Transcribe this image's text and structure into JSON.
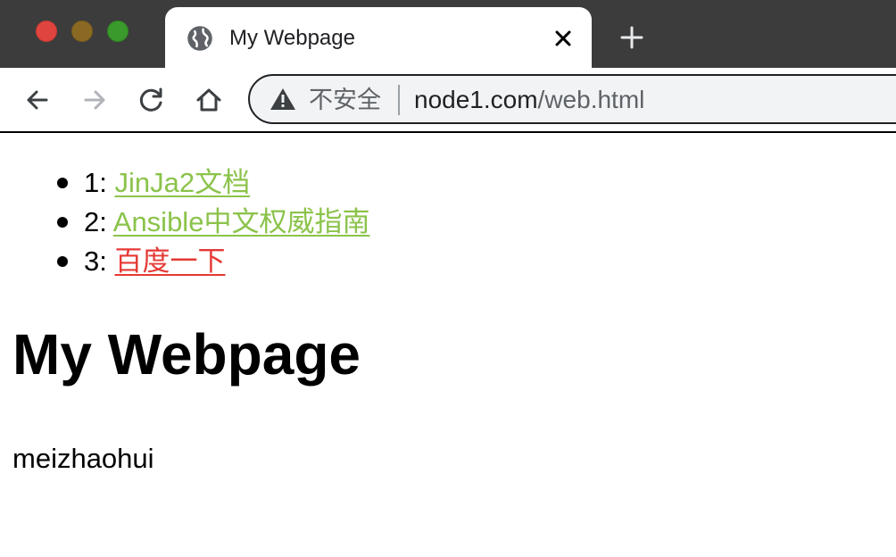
{
  "browser": {
    "tab": {
      "title": "My Webpage"
    },
    "address_bar": {
      "security_label": "不安全",
      "url_host": "node1.com",
      "url_path": "/web.html"
    },
    "icons": [
      "globe-icon",
      "close-icon",
      "plus-icon",
      "back-arrow-icon",
      "forward-arrow-icon",
      "reload-icon",
      "home-icon",
      "warning-icon"
    ]
  },
  "page": {
    "links": [
      {
        "prefix": "1:",
        "text": "JinJa2文档",
        "color": "#8bc34a"
      },
      {
        "prefix": "2:",
        "text": "Ansible中文权威指南",
        "color": "#8bc34a"
      },
      {
        "prefix": "3:",
        "text": "百度一下",
        "color": "#e53935"
      }
    ],
    "heading": "My Webpage",
    "author": "meizhaohui"
  }
}
